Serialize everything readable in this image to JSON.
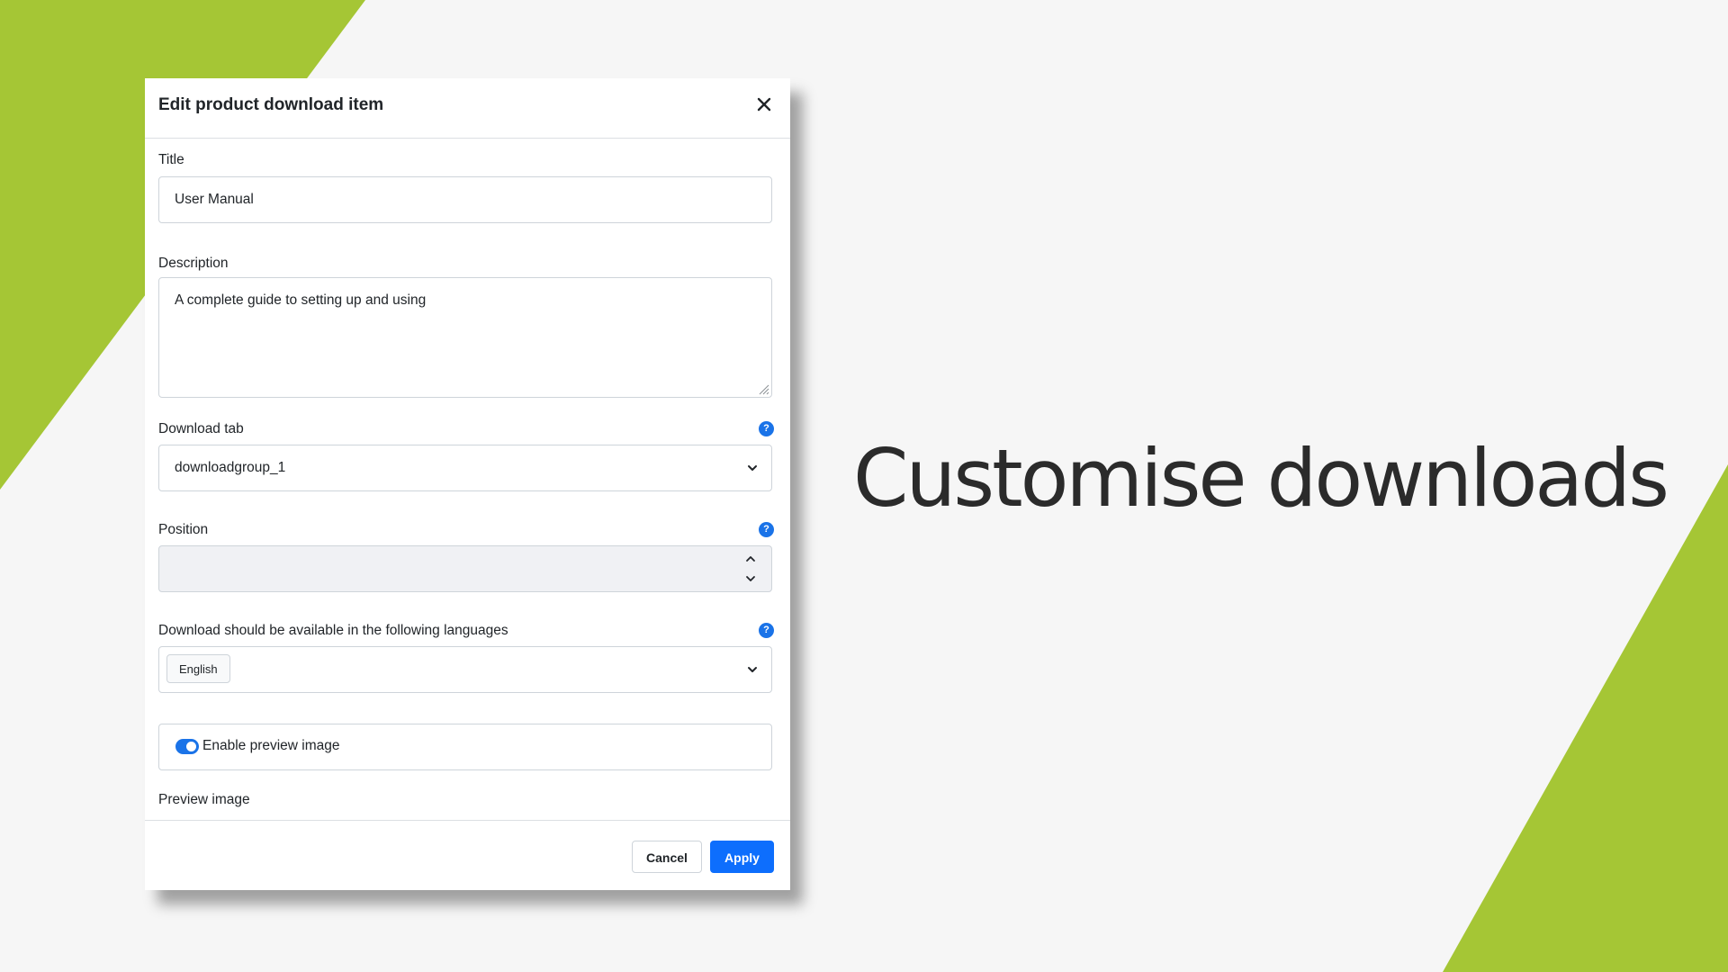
{
  "colors": {
    "accent_green": "#a5c635",
    "primary_blue": "#0d6efd",
    "headline": "#2b2b2b"
  },
  "slide": {
    "headline": "Customise downloads"
  },
  "dialog": {
    "title": "Edit product download item",
    "close_icon": "close-icon",
    "fields": {
      "title": {
        "label": "Title",
        "value": "User Manual"
      },
      "description": {
        "label": "Description",
        "value": "A complete guide to setting up and using"
      },
      "download_tab": {
        "label": "Download tab",
        "value": "downloadgroup_1",
        "help_icon": "help-icon"
      },
      "position": {
        "label": "Position",
        "value": "",
        "help_icon": "help-icon"
      },
      "languages": {
        "label": "Download should be available in the following languages",
        "selected": [
          "English"
        ],
        "help_icon": "help-icon"
      },
      "preview_toggle": {
        "label": "Enable preview image",
        "on": true
      },
      "preview_image": {
        "label": "Preview image"
      }
    },
    "footer": {
      "cancel_label": "Cancel",
      "apply_label": "Apply"
    }
  }
}
